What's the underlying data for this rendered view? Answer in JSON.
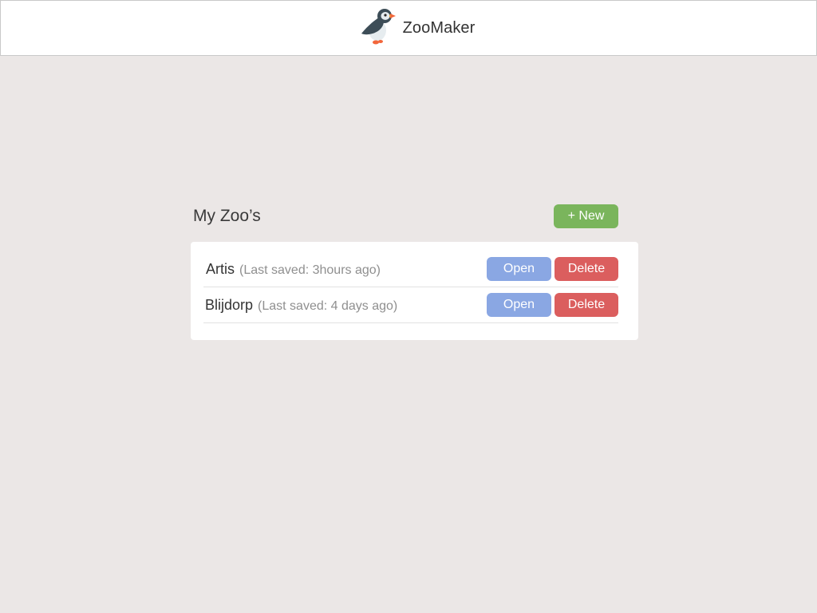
{
  "header": {
    "app_title": "ZooMaker",
    "logo_icon": "puffin-icon"
  },
  "main": {
    "title": "My Zoo’s",
    "new_label": "+ New"
  },
  "zoos": [
    {
      "name": "Artis",
      "meta": "(Last saved: 3hours ago)",
      "open_label": "Open",
      "delete_label": "Delete"
    },
    {
      "name": "Blijdorp",
      "meta": "(Last saved: 4 days ago)",
      "open_label": "Open",
      "delete_label": "Delete"
    }
  ],
  "colors": {
    "background": "#ebe7e6",
    "new_button": "#7ab55c",
    "open_button": "#8aa7e3",
    "delete_button": "#db5e5e"
  }
}
